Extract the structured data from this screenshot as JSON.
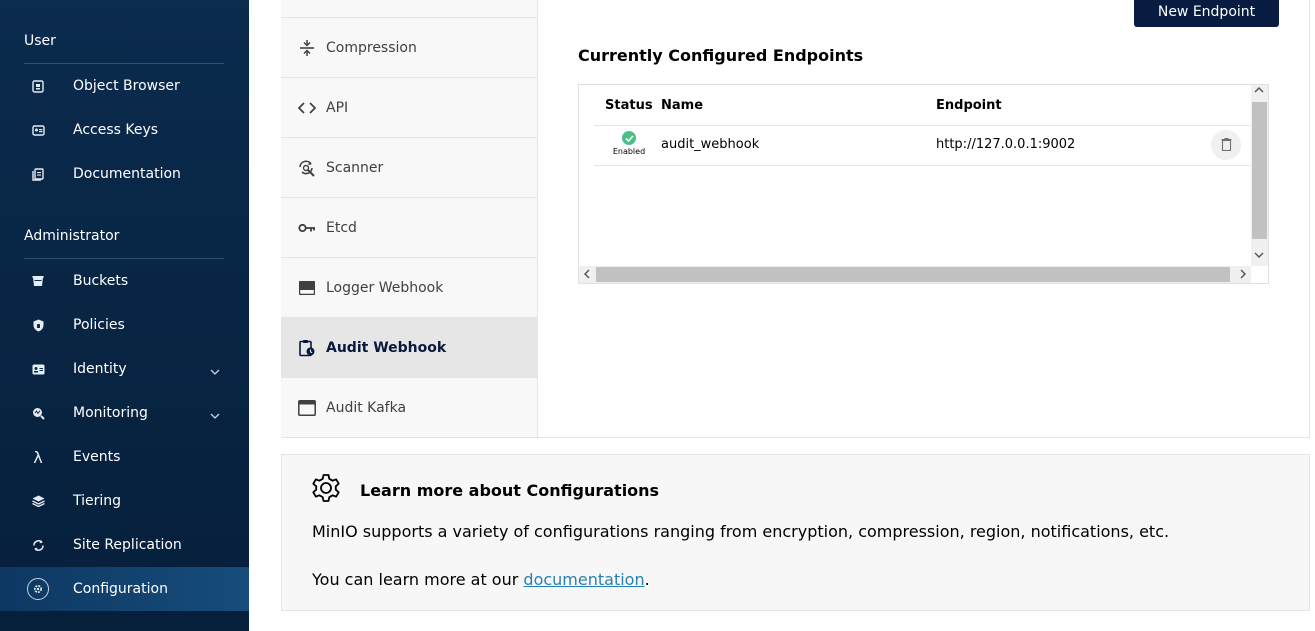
{
  "sidebar": {
    "user_section": "User",
    "admin_section": "Administrator",
    "user_items": [
      {
        "label": "Object Browser",
        "icon": "object-browser-icon"
      },
      {
        "label": "Access Keys",
        "icon": "access-keys-icon"
      },
      {
        "label": "Documentation",
        "icon": "documentation-icon"
      }
    ],
    "admin_items": [
      {
        "label": "Buckets",
        "icon": "bucket-icon"
      },
      {
        "label": "Policies",
        "icon": "policy-shield-icon"
      },
      {
        "label": "Identity",
        "icon": "identity-icon"
      },
      {
        "label": "Monitoring",
        "icon": "monitoring-icon"
      },
      {
        "label": "Events",
        "icon": "lambda-icon"
      },
      {
        "label": "Tiering",
        "icon": "tiering-icon"
      },
      {
        "label": "Site Replication",
        "icon": "site-replication-icon"
      },
      {
        "label": "Configuration",
        "icon": "gear-icon"
      }
    ],
    "active_item": "Configuration"
  },
  "config_menu": {
    "items": [
      {
        "label": "Compression",
        "icon": "compression-icon"
      },
      {
        "label": "API",
        "icon": "code-icon"
      },
      {
        "label": "Scanner",
        "icon": "scanner-icon"
      },
      {
        "label": "Etcd",
        "icon": "key-icon"
      },
      {
        "label": "Logger Webhook",
        "icon": "logger-webhook-icon"
      },
      {
        "label": "Audit Webhook",
        "icon": "audit-webhook-icon"
      },
      {
        "label": "Audit Kafka",
        "icon": "audit-kafka-icon"
      }
    ],
    "active_item": "Audit Webhook"
  },
  "main": {
    "new_button": "New Endpoint",
    "title": "Currently Configured Endpoints",
    "table": {
      "headers": [
        "Status",
        "Name",
        "Endpoint"
      ],
      "rows": [
        {
          "status": "Enabled",
          "name": "audit_webhook",
          "endpoint": "http://127.0.0.1:9002"
        }
      ]
    }
  },
  "learn": {
    "title": "Learn more about Configurations",
    "text1": "MinIO supports a variety of configurations ranging from encryption, compression, region, notifications, etc.",
    "text2_prefix": "You can learn more at our ",
    "link": "documentation",
    "text2_suffix": "."
  },
  "colors": {
    "sidebar_bg": "#082644",
    "primary_button": "#081c42",
    "status_enabled": "#4cbf84",
    "link": "#2781b0"
  }
}
